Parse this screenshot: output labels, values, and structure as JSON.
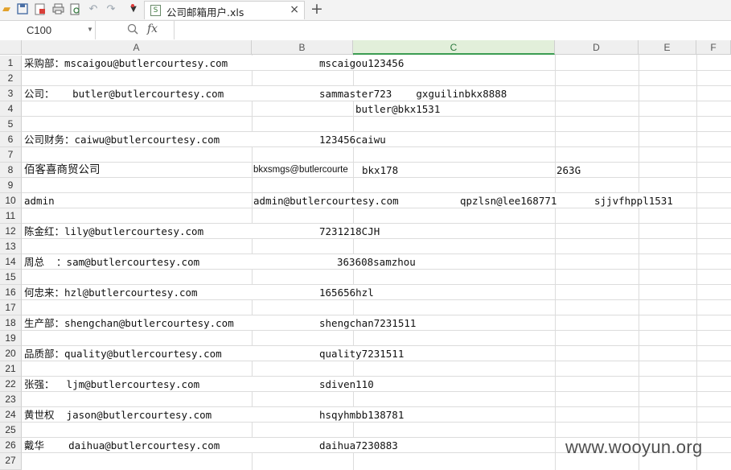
{
  "toolbar": {
    "icons": [
      "open-folder-icon",
      "save-icon",
      "export-pdf-icon",
      "print-icon",
      "print-preview-icon",
      "undo-icon",
      "redo-icon",
      "more-dropdown-icon"
    ],
    "tab_label": "公司邮箱用户.xls",
    "close_glyph": "×",
    "new_tab_glyph": "+"
  },
  "formula_bar": {
    "name_box": "C100",
    "fx_label": "fx",
    "formula": ""
  },
  "columns": [
    "A",
    "B",
    "C",
    "D",
    "E",
    "F"
  ],
  "rows": [
    "1",
    "2",
    "3",
    "4",
    "5",
    "6",
    "7",
    "8",
    "9",
    "10",
    "11",
    "12",
    "13",
    "14",
    "15",
    "16",
    "17",
    "18",
    "19",
    "20",
    "21",
    "22",
    "23",
    "24",
    "25",
    "26",
    "27"
  ],
  "cells": {
    "r1a": "采购部：mscaigou@butlercourtesy.com",
    "r1c": "mscaigou123456",
    "r3a": "公司：   butler@butlercourtesy.com",
    "r3c": "sammaster723    gxguilinbkx8888",
    "r4c": "butler@bkx1531",
    "r6a": "公司财务：caiwu@butlercourtesy.com",
    "r6c": "123456caiwu",
    "r8a": "佰客喜商贸公司",
    "r8b": "bkxsmgs@butlercourte",
    "r8c": "bkx178",
    "r8d": "263G",
    "r10a": "admin",
    "r10b": "admin@butlercourtesy.com",
    "r10c": "qpzlsn@lee168771",
    "r10d": "sjjvfhppl1531",
    "r12a": "陈金红：lily@butlercourtesy.com",
    "r12c": "7231218CJH",
    "r14a": "周总  ：sam@butlercourtesy.com",
    "r14c": "363608samzhou",
    "r16a": "何忠来：hzl@butlercourtesy.com",
    "r16c": "165656hzl",
    "r18a": "生产部：shengchan@butlercourtesy.com",
    "r18c": "shengchan7231511",
    "r20a": "品质部：quality@butlercourtesy.com",
    "r20c": "quality7231511",
    "r22a": "张强：  ljm@butlercourtesy.com",
    "r22c": "sdiven110",
    "r24a": "黄世权  jason@butlercourtesy.com",
    "r24c": "hsqyhmbb138781",
    "r26a": "戴华    daihua@butlercourtesy.com",
    "r26c": "daihua7230883"
  },
  "watermark": "www.wooyun.org"
}
